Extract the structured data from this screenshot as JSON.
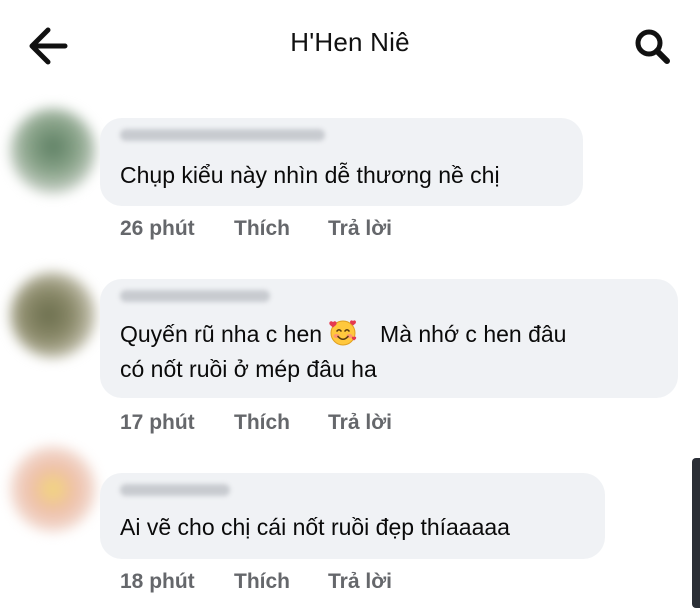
{
  "header": {
    "title": "H'Hen Niê",
    "back_icon": "arrow-left-icon",
    "search_icon": "search-icon"
  },
  "comments": [
    {
      "text_lines": [
        "Chụp kiểu này nhìn dễ thương nề chị"
      ],
      "time": "26 phút",
      "like": "Thích",
      "reply": "Trả lời",
      "avatar_color": "#7f9a7a"
    },
    {
      "text_line1": "Quyến rũ nha c hen",
      "emoji": "smiling-face-with-hearts-icon",
      "text_line1_tail": "Mà nhớ c hen đâu",
      "text_line2": "có nốt ruồi ở mép đâu ha",
      "time": "17 phút",
      "like": "Thích",
      "reply": "Trả lời",
      "avatar_color": "#8a8b6c"
    },
    {
      "text_lines": [
        "Ai vẽ cho chị cái nốt ruồi đẹp thíaaaaa"
      ],
      "time": "18 phút",
      "like": "Thích",
      "reply": "Trả lời",
      "avatar_color": "#e8c9a8"
    }
  ],
  "colors": {
    "bubble": "#f0f2f5",
    "meta_text": "#65676b",
    "text": "#0a0a0a"
  }
}
